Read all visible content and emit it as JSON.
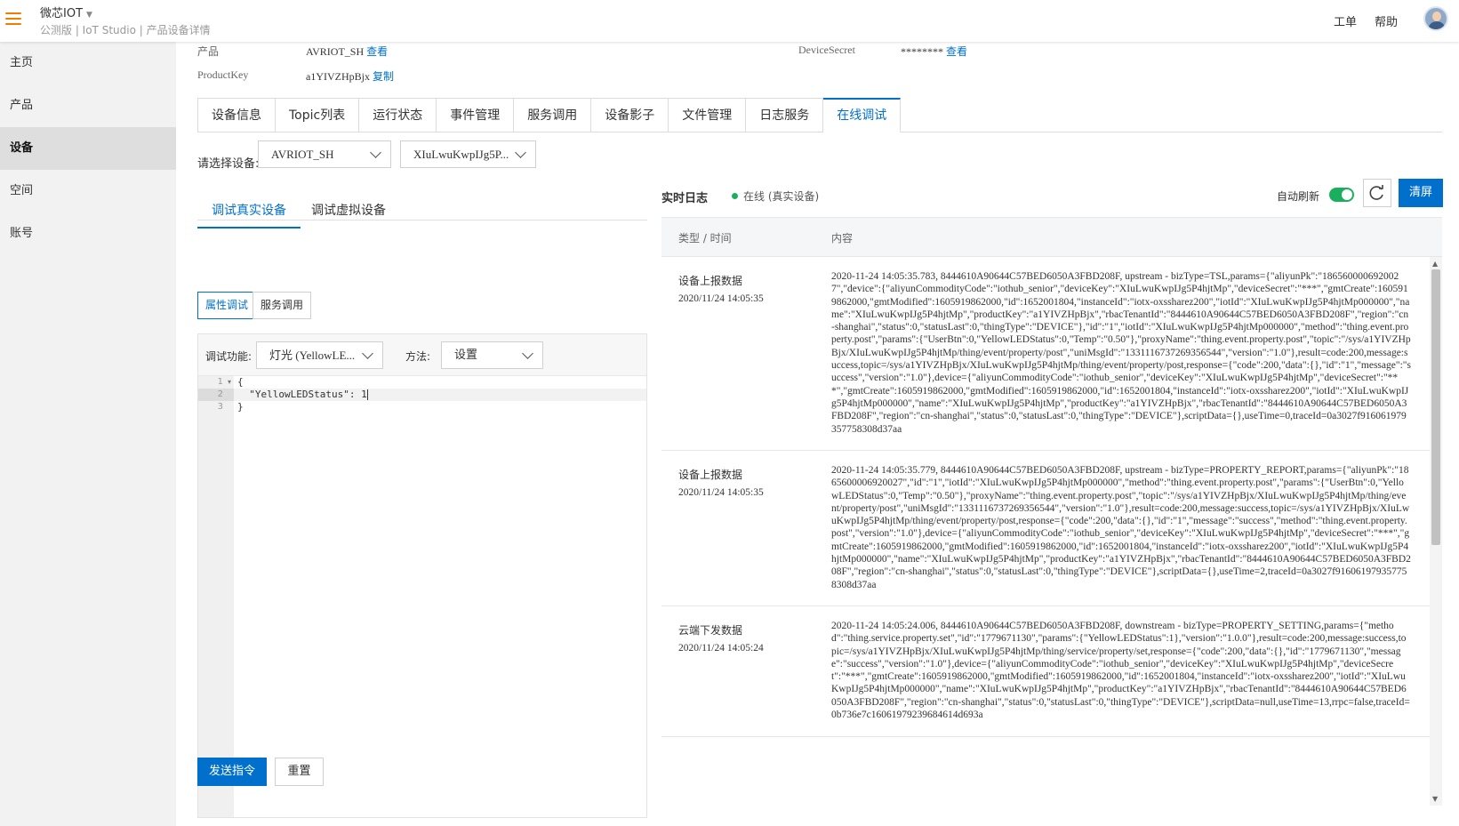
{
  "header": {
    "app_title": "微芯IOT",
    "breadcrumb": "公测版 | IoT Studio | 产品设备详情",
    "links": [
      "工单",
      "帮助"
    ]
  },
  "sidebar": {
    "items": [
      {
        "label": "主页",
        "active": false
      },
      {
        "label": "产品",
        "active": false
      },
      {
        "label": "设备",
        "active": true
      },
      {
        "label": "空间",
        "active": false
      },
      {
        "label": "账号",
        "active": false
      }
    ]
  },
  "device_info": {
    "product_label": "产品",
    "product_value": "AVRIOT_SH",
    "product_link": "查看",
    "productkey_label": "ProductKey",
    "productkey_value": "a1YIVZHpBjx",
    "productkey_link": "复制",
    "secret_label": "DeviceSecret",
    "secret_value": "********",
    "secret_link": "查看"
  },
  "tabs": [
    {
      "label": "设备信息",
      "active": false
    },
    {
      "label": "Topic列表",
      "active": false
    },
    {
      "label": "运行状态",
      "active": false
    },
    {
      "label": "事件管理",
      "active": false
    },
    {
      "label": "服务调用",
      "active": false
    },
    {
      "label": "设备影子",
      "active": false
    },
    {
      "label": "文件管理",
      "active": false
    },
    {
      "label": "日志服务",
      "active": false
    },
    {
      "label": "在线调试",
      "active": true
    }
  ],
  "debug": {
    "select_label": "请选择设备:",
    "product_select": "AVRIOT_SH",
    "device_select": "XIuLwuKwpIJg5P...",
    "subtabs": [
      {
        "label": "调试真实设备",
        "active": true
      },
      {
        "label": "调试虚拟设备",
        "active": false
      }
    ],
    "modes": [
      {
        "label": "属性调试",
        "active": true
      },
      {
        "label": "服务调用",
        "active": false
      }
    ],
    "function_label": "调试功能:",
    "function_value": "灯光 (YellowLE...",
    "method_label": "方法:",
    "method_value": "设置",
    "line_numbers": [
      "1",
      "2",
      "3"
    ],
    "code_lines": [
      "{",
      "  \"YellowLEDStatus\": 1",
      "}"
    ],
    "send_button": "发送指令",
    "reset_button": "重置"
  },
  "log": {
    "title": "实时日志",
    "status": "在线 (真实设备)",
    "auto_refresh_label": "自动刷新",
    "auto_refresh_on": true,
    "clear_button": "清屏",
    "col_type_time": "类型 / 时间",
    "col_content": "内容",
    "rows": [
      {
        "type": "设备上报数据",
        "time": "2020/11/24 14:05:35",
        "content": "2020-11-24 14:05:35.783, 8444610A90644C57BED6050A3FBD208F, upstream - bizType=TSL,params={\"aliyunPk\":\"1865600006920027\",\"device\":{\"aliyunCommodityCode\":\"iothub_senior\",\"deviceKey\":\"XIuLwuKwpIJg5P4hjtMp\",\"deviceSecret\":\"***\",\"gmtCreate\":1605919862000,\"gmtModified\":1605919862000,\"id\":1652001804,\"instanceId\":\"iotx-oxssharez200\",\"iotId\":\"XIuLwuKwpIJg5P4hjtMp000000\",\"name\":\"XIuLwuKwpIJg5P4hjtMp\",\"productKey\":\"a1YIVZHpBjx\",\"rbacTenantId\":\"8444610A90644C57BED6050A3FBD208F\",\"region\":\"cn-shanghai\",\"status\":0,\"statusLast\":0,\"thingType\":\"DEVICE\"},\"id\":\"1\",\"iotId\":\"XIuLwuKwpIJg5P4hjtMp000000\",\"method\":\"thing.event.property.post\",\"params\":{\"UserBtn\":0,\"YellowLEDStatus\":0,\"Temp\":\"0.50\"},\"proxyName\":\"thing.event.property.post\",\"topic\":\"/sys/a1YIVZHpBjx/XIuLwuKwpIJg5P4hjtMp/thing/event/property/post\",\"uniMsgId\":\"1331116737269356544\",\"version\":\"1.0\"},result=code:200,message:success,topic=/sys/a1YIVZHpBjx/XIuLwuKwpIJg5P4hjtMp/thing/event/property/post,response={\"code\":200,\"data\":{},\"id\":\"1\",\"message\":\"success\",\"version\":\"1.0\"},device={\"aliyunCommodityCode\":\"iothub_senior\",\"deviceKey\":\"XIuLwuKwpIJg5P4hjtMp\",\"deviceSecret\":\"***\",\"gmtCreate\":1605919862000,\"gmtModified\":1605919862000,\"id\":1652001804,\"instanceId\":\"iotx-oxssharez200\",\"iotId\":\"XIuLwuKwpIJg5P4hjtMp000000\",\"name\":\"XIuLwuKwpIJg5P4hjtMp\",\"productKey\":\"a1YIVZHpBjx\",\"rbacTenantId\":\"8444610A90644C57BED6050A3FBD208F\",\"region\":\"cn-shanghai\",\"status\":0,\"statusLast\":0,\"thingType\":\"DEVICE\"},scriptData={},useTime=0,traceId=0a3027f916061979357758308d37aa"
      },
      {
        "type": "设备上报数据",
        "time": "2020/11/24 14:05:35",
        "content": "2020-11-24 14:05:35.779, 8444610A90644C57BED6050A3FBD208F, upstream - bizType=PROPERTY_REPORT,params={\"aliyunPk\":\"1865600006920027\",\"id\":\"1\",\"iotId\":\"XIuLwuKwpIJg5P4hjtMp000000\",\"method\":\"thing.event.property.post\",\"params\":{\"UserBtn\":0,\"YellowLEDStatus\":0,\"Temp\":\"0.50\"},\"proxyName\":\"thing.event.property.post\",\"topic\":\"/sys/a1YIVZHpBjx/XIuLwuKwpIJg5P4hjtMp/thing/event/property/post\",\"uniMsgId\":\"1331116737269356544\",\"version\":\"1.0\"},result=code:200,message:success,topic=/sys/a1YIVZHpBjx/XIuLwuKwpIJg5P4hjtMp/thing/event/property/post,response={\"code\":200,\"data\":{},\"id\":\"1\",\"message\":\"success\",\"method\":\"thing.event.property.post\",\"version\":\"1.0\"},device={\"aliyunCommodityCode\":\"iothub_senior\",\"deviceKey\":\"XIuLwuKwpIJg5P4hjtMp\",\"deviceSecret\":\"***\",\"gmtCreate\":1605919862000,\"gmtModified\":1605919862000,\"id\":1652001804,\"instanceId\":\"iotx-oxssharez200\",\"iotId\":\"XIuLwuKwpIJg5P4hjtMp000000\",\"name\":\"XIuLwuKwpIJg5P4hjtMp\",\"productKey\":\"a1YIVZHpBjx\",\"rbacTenantId\":\"8444610A90644C57BED6050A3FBD208F\",\"region\":\"cn-shanghai\",\"status\":0,\"statusLast\":0,\"thingType\":\"DEVICE\"},scriptData={},useTime=2,traceId=0a3027f916061979357758308d37aa"
      },
      {
        "type": "云端下发数据",
        "time": "2020/11/24 14:05:24",
        "content": "2020-11-24 14:05:24.006, 8444610A90644C57BED6050A3FBD208F, downstream - bizType=PROPERTY_SETTING,params={\"method\":\"thing.service.property.set\",\"id\":\"1779671130\",\"params\":{\"YellowLEDStatus\":1},\"version\":\"1.0.0\"},result=code:200,message:success,topic=/sys/a1YIVZHpBjx/XIuLwuKwpIJg5P4hjtMp/thing/service/property/set,response={\"code\":200,\"data\":{},\"id\":\"1779671130\",\"message\":\"success\",\"version\":\"1.0\"},device={\"aliyunCommodityCode\":\"iothub_senior\",\"deviceKey\":\"XIuLwuKwpIJg5P4hjtMp\",\"deviceSecret\":\"***\",\"gmtCreate\":1605919862000,\"gmtModified\":1605919862000,\"id\":1652001804,\"instanceId\":\"iotx-oxssharez200\",\"iotId\":\"XIuLwuKwpIJg5P4hjtMp000000\",\"name\":\"XIuLwuKwpIJg5P4hjtMp\",\"productKey\":\"a1YIVZHpBjx\",\"rbacTenantId\":\"8444610A90644C57BED6050A3FBD208F\",\"region\":\"cn-shanghai\",\"status\":0,\"statusLast\":0,\"thingType\":\"DEVICE\"},scriptData=null,useTime=13,rrpc=false,traceId=0b736e7c16061979239684614d693a"
      }
    ]
  },
  "colors": {
    "brand_orange": "#f07c00",
    "primary_blue": "#0070cc",
    "online_green": "#1aaf5d"
  },
  "icons": [
    "menu-icon",
    "chevron-down-icon",
    "avatar",
    "refresh-icon",
    "online-status-dot"
  ]
}
